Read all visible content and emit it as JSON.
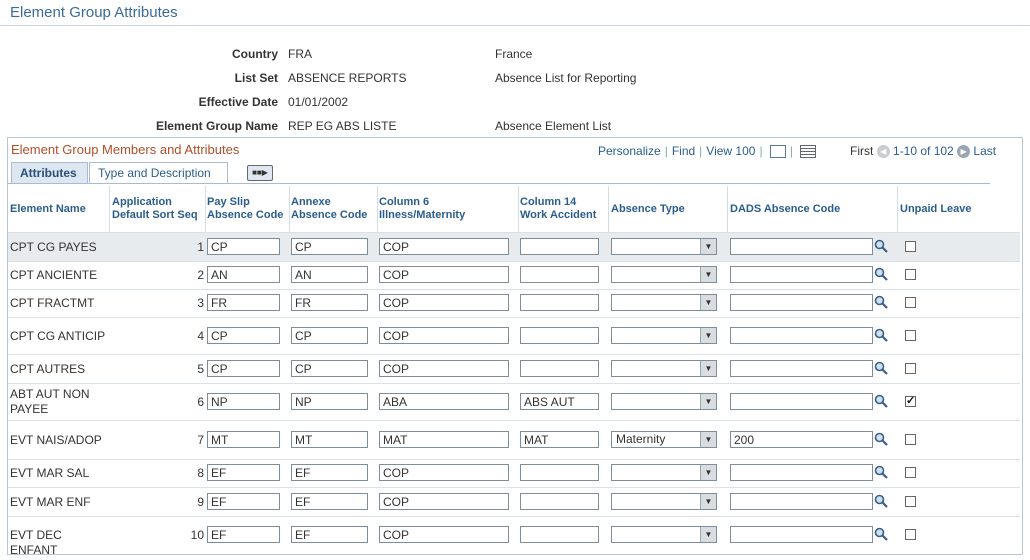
{
  "page": {
    "title": "Element Group Attributes"
  },
  "header": {
    "fields": [
      {
        "label": "Country",
        "value": "FRA",
        "description": "France"
      },
      {
        "label": "List Set",
        "value": "ABSENCE REPORTS",
        "description": "Absence List for Reporting"
      },
      {
        "label": "Effective Date",
        "value": "01/01/2002",
        "description": ""
      },
      {
        "label": "Element Group Name",
        "value": "REP EG ABS LISTE",
        "description": "Absence Element List"
      }
    ]
  },
  "grid": {
    "title": "Element Group Members and Attributes",
    "personalize": "Personalize",
    "find": "Find",
    "view": "View 100",
    "first": "First",
    "range": "1-10 of 102",
    "last": "Last",
    "tabs": [
      "Attributes",
      "Type and Description"
    ],
    "columns": [
      "Element Name",
      "Application Default Sort Seq",
      "Pay Slip Absence Code",
      "Annexe Absence Code",
      "Column 6 Illness/Maternity",
      "Column 14 Work Accident",
      "Absence Type",
      "DADS Absence Code",
      "Unpaid Leave"
    ],
    "rows": [
      {
        "name": "CPT CG PAYES",
        "seq": "1",
        "payslip": "CP",
        "annexe": "CP",
        "col6": "COP",
        "col14": "",
        "absence_type": "",
        "dads": "",
        "unpaid": false
      },
      {
        "name": "CPT ANCIENTE",
        "seq": "2",
        "payslip": "AN",
        "annexe": "AN",
        "col6": "COP",
        "col14": "",
        "absence_type": "",
        "dads": "",
        "unpaid": false
      },
      {
        "name": "CPT FRACTMT",
        "seq": "3",
        "payslip": "FR",
        "annexe": "FR",
        "col6": "COP",
        "col14": "",
        "absence_type": "",
        "dads": "",
        "unpaid": false
      },
      {
        "name": "CPT CG ANTICIP",
        "seq": "4",
        "payslip": "CP",
        "annexe": "CP",
        "col6": "COP",
        "col14": "",
        "absence_type": "",
        "dads": "",
        "unpaid": false
      },
      {
        "name": "CPT AUTRES",
        "seq": "5",
        "payslip": "CP",
        "annexe": "CP",
        "col6": "COP",
        "col14": "",
        "absence_type": "",
        "dads": "",
        "unpaid": false
      },
      {
        "name": "ABT AUT NON PAYEE",
        "seq": "6",
        "payslip": "NP",
        "annexe": "NP",
        "col6": "ABA",
        "col14": "ABS AUT",
        "absence_type": "",
        "dads": "",
        "unpaid": true
      },
      {
        "name": "EVT NAIS/ADOP",
        "seq": "7",
        "payslip": "MT",
        "annexe": "MT",
        "col6": "MAT",
        "col14": "MAT",
        "absence_type": "Maternity",
        "dads": "200",
        "unpaid": false
      },
      {
        "name": "EVT MAR SAL",
        "seq": "8",
        "payslip": "EF",
        "annexe": "EF",
        "col6": "COP",
        "col14": "",
        "absence_type": "",
        "dads": "",
        "unpaid": false
      },
      {
        "name": "EVT MAR ENF",
        "seq": "9",
        "payslip": "EF",
        "annexe": "EF",
        "col6": "COP",
        "col14": "",
        "absence_type": "",
        "dads": "",
        "unpaid": false
      },
      {
        "name": "EVT DEC ENFANT",
        "seq": "10",
        "payslip": "EF",
        "annexe": "EF",
        "col6": "COP",
        "col14": "",
        "absence_type": "",
        "dads": "",
        "unpaid": false
      }
    ]
  }
}
